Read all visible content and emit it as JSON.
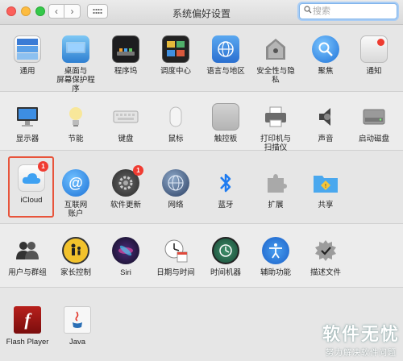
{
  "window": {
    "title": "系统偏好设置"
  },
  "toolbar": {
    "back_symbol": "‹",
    "forward_symbol": "›"
  },
  "search": {
    "placeholder": "搜索",
    "value": ""
  },
  "sections": [
    {
      "items": [
        {
          "label": "通用",
          "icon": "general-icon"
        },
        {
          "label": "桌面与\n屏幕保护程序",
          "icon": "desktop-screensaver-icon"
        },
        {
          "label": "程序坞",
          "icon": "dock-icon"
        },
        {
          "label": "调度中心",
          "icon": "mission-control-icon"
        },
        {
          "label": "语言与地区",
          "icon": "language-region-icon"
        },
        {
          "label": "安全性与隐私",
          "icon": "security-privacy-icon"
        },
        {
          "label": "聚焦",
          "icon": "spotlight-icon"
        },
        {
          "label": "通知",
          "icon": "notifications-icon"
        }
      ]
    },
    {
      "items": [
        {
          "label": "显示器",
          "icon": "displays-icon"
        },
        {
          "label": "节能",
          "icon": "energy-saver-icon"
        },
        {
          "label": "键盘",
          "icon": "keyboard-icon"
        },
        {
          "label": "鼠标",
          "icon": "mouse-icon"
        },
        {
          "label": "触控板",
          "icon": "trackpad-icon"
        },
        {
          "label": "打印机与\n扫描仪",
          "icon": "printers-scanners-icon"
        },
        {
          "label": "声音",
          "icon": "sound-icon"
        },
        {
          "label": "启动磁盘",
          "icon": "startup-disk-icon"
        }
      ]
    },
    {
      "items": [
        {
          "label": "iCloud",
          "icon": "icloud-icon",
          "badge": "1"
        },
        {
          "label": "互联网\n账户",
          "icon": "internet-accounts-icon"
        },
        {
          "label": "软件更新",
          "icon": "software-update-icon",
          "badge": "1"
        },
        {
          "label": "网络",
          "icon": "network-icon"
        },
        {
          "label": "蓝牙",
          "icon": "bluetooth-icon"
        },
        {
          "label": "扩展",
          "icon": "extensions-icon"
        },
        {
          "label": "共享",
          "icon": "sharing-icon"
        }
      ]
    },
    {
      "items": [
        {
          "label": "用户与群组",
          "icon": "users-groups-icon"
        },
        {
          "label": "家长控制",
          "icon": "parental-controls-icon"
        },
        {
          "label": "Siri",
          "icon": "siri-icon"
        },
        {
          "label": "日期与时间",
          "icon": "date-time-icon"
        },
        {
          "label": "时间机器",
          "icon": "time-machine-icon"
        },
        {
          "label": "辅助功能",
          "icon": "accessibility-icon"
        },
        {
          "label": "描述文件",
          "icon": "profiles-icon"
        }
      ]
    },
    {
      "items": [
        {
          "label": "Flash Player",
          "icon": "flash-player-icon"
        },
        {
          "label": "Java",
          "icon": "java-icon"
        }
      ]
    }
  ],
  "watermark": {
    "title": "软件无忧",
    "subtitle": "努力解决软件问题"
  }
}
